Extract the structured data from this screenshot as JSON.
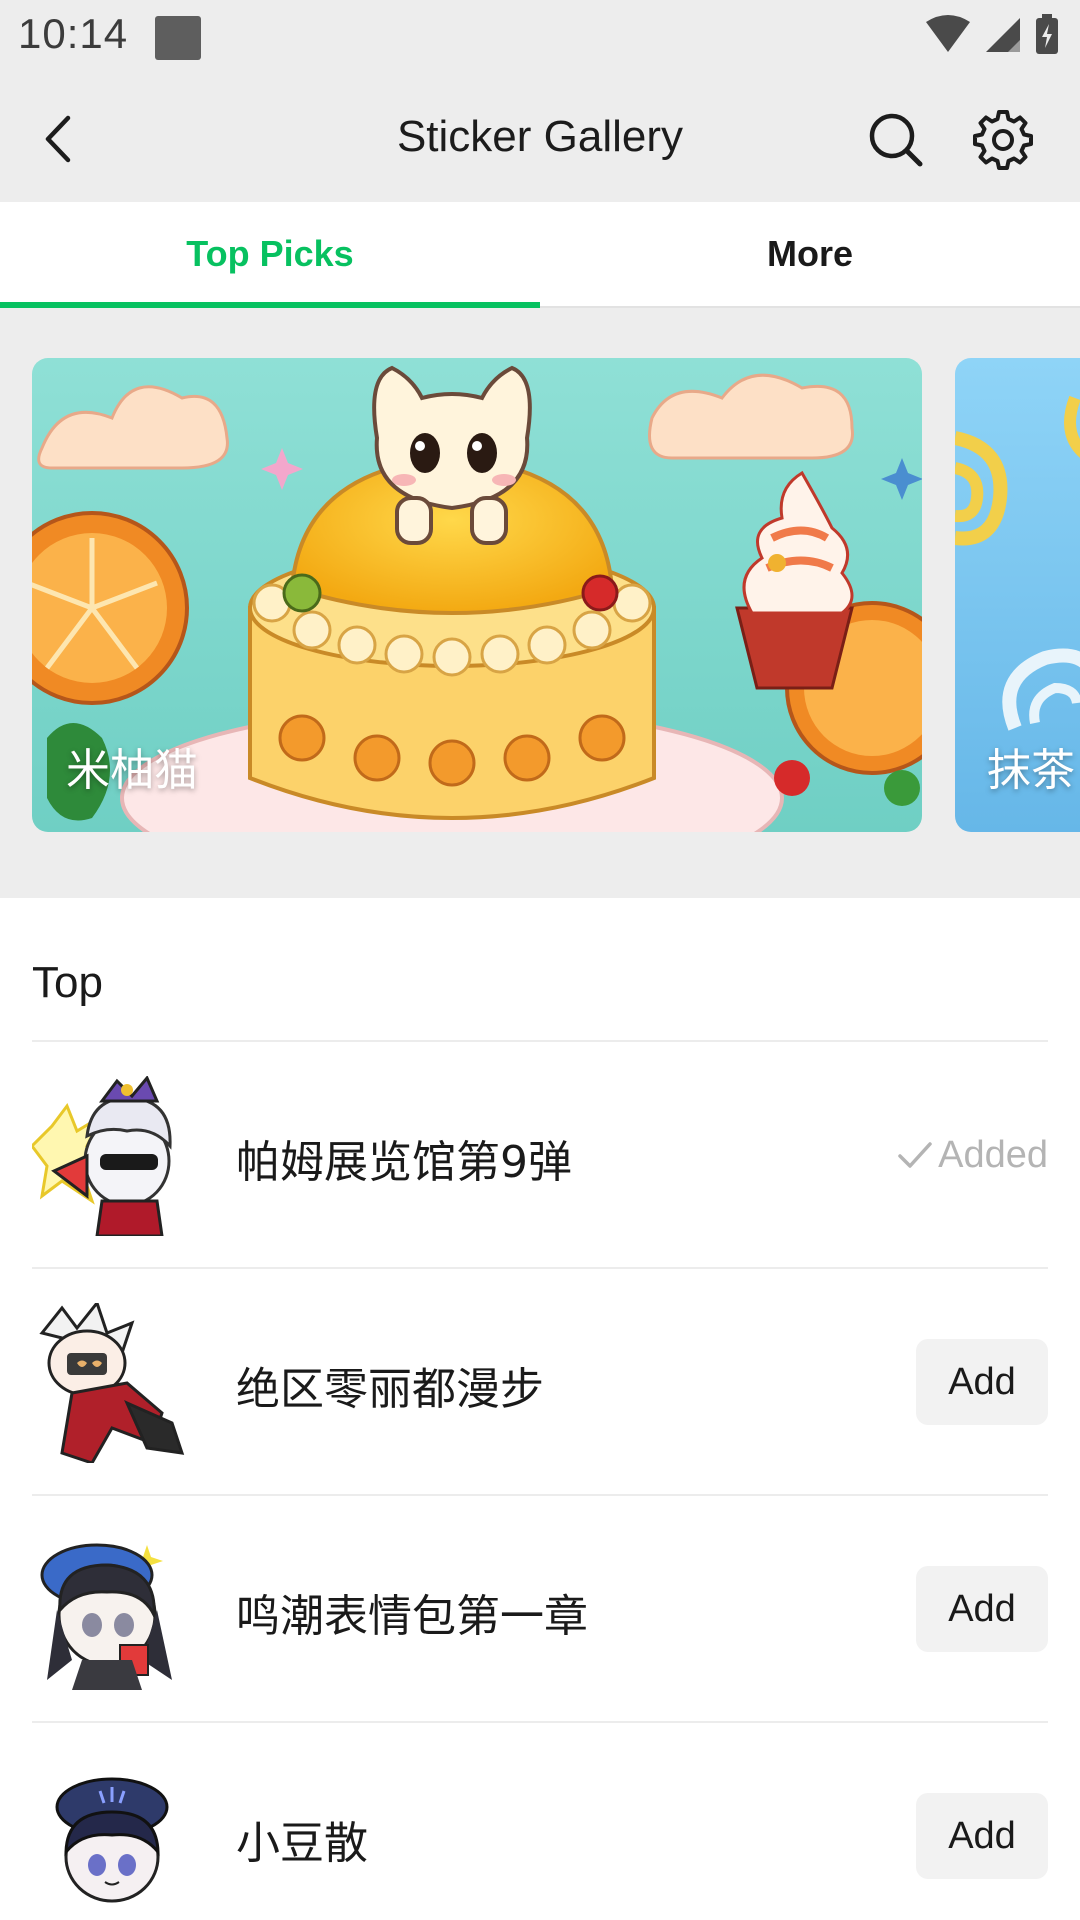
{
  "status_bar": {
    "time": "10:14"
  },
  "app_bar": {
    "title": "Sticker Gallery"
  },
  "tabs": [
    {
      "label": "Top Picks",
      "active": true
    },
    {
      "label": "More",
      "active": false
    }
  ],
  "banners": [
    {
      "label": "米柚猫"
    },
    {
      "label": "抹茶"
    }
  ],
  "section": {
    "title": "Top"
  },
  "stickers": [
    {
      "name": "帕姆展览馆第9弹",
      "status": "Added"
    },
    {
      "name": "绝区零丽都漫步",
      "action": "Add"
    },
    {
      "name": "鸣潮表情包第一章",
      "action": "Add"
    },
    {
      "name": "小豆散",
      "action": "Add"
    }
  ],
  "colors": {
    "accent": "#07c160",
    "background": "#ededed"
  }
}
